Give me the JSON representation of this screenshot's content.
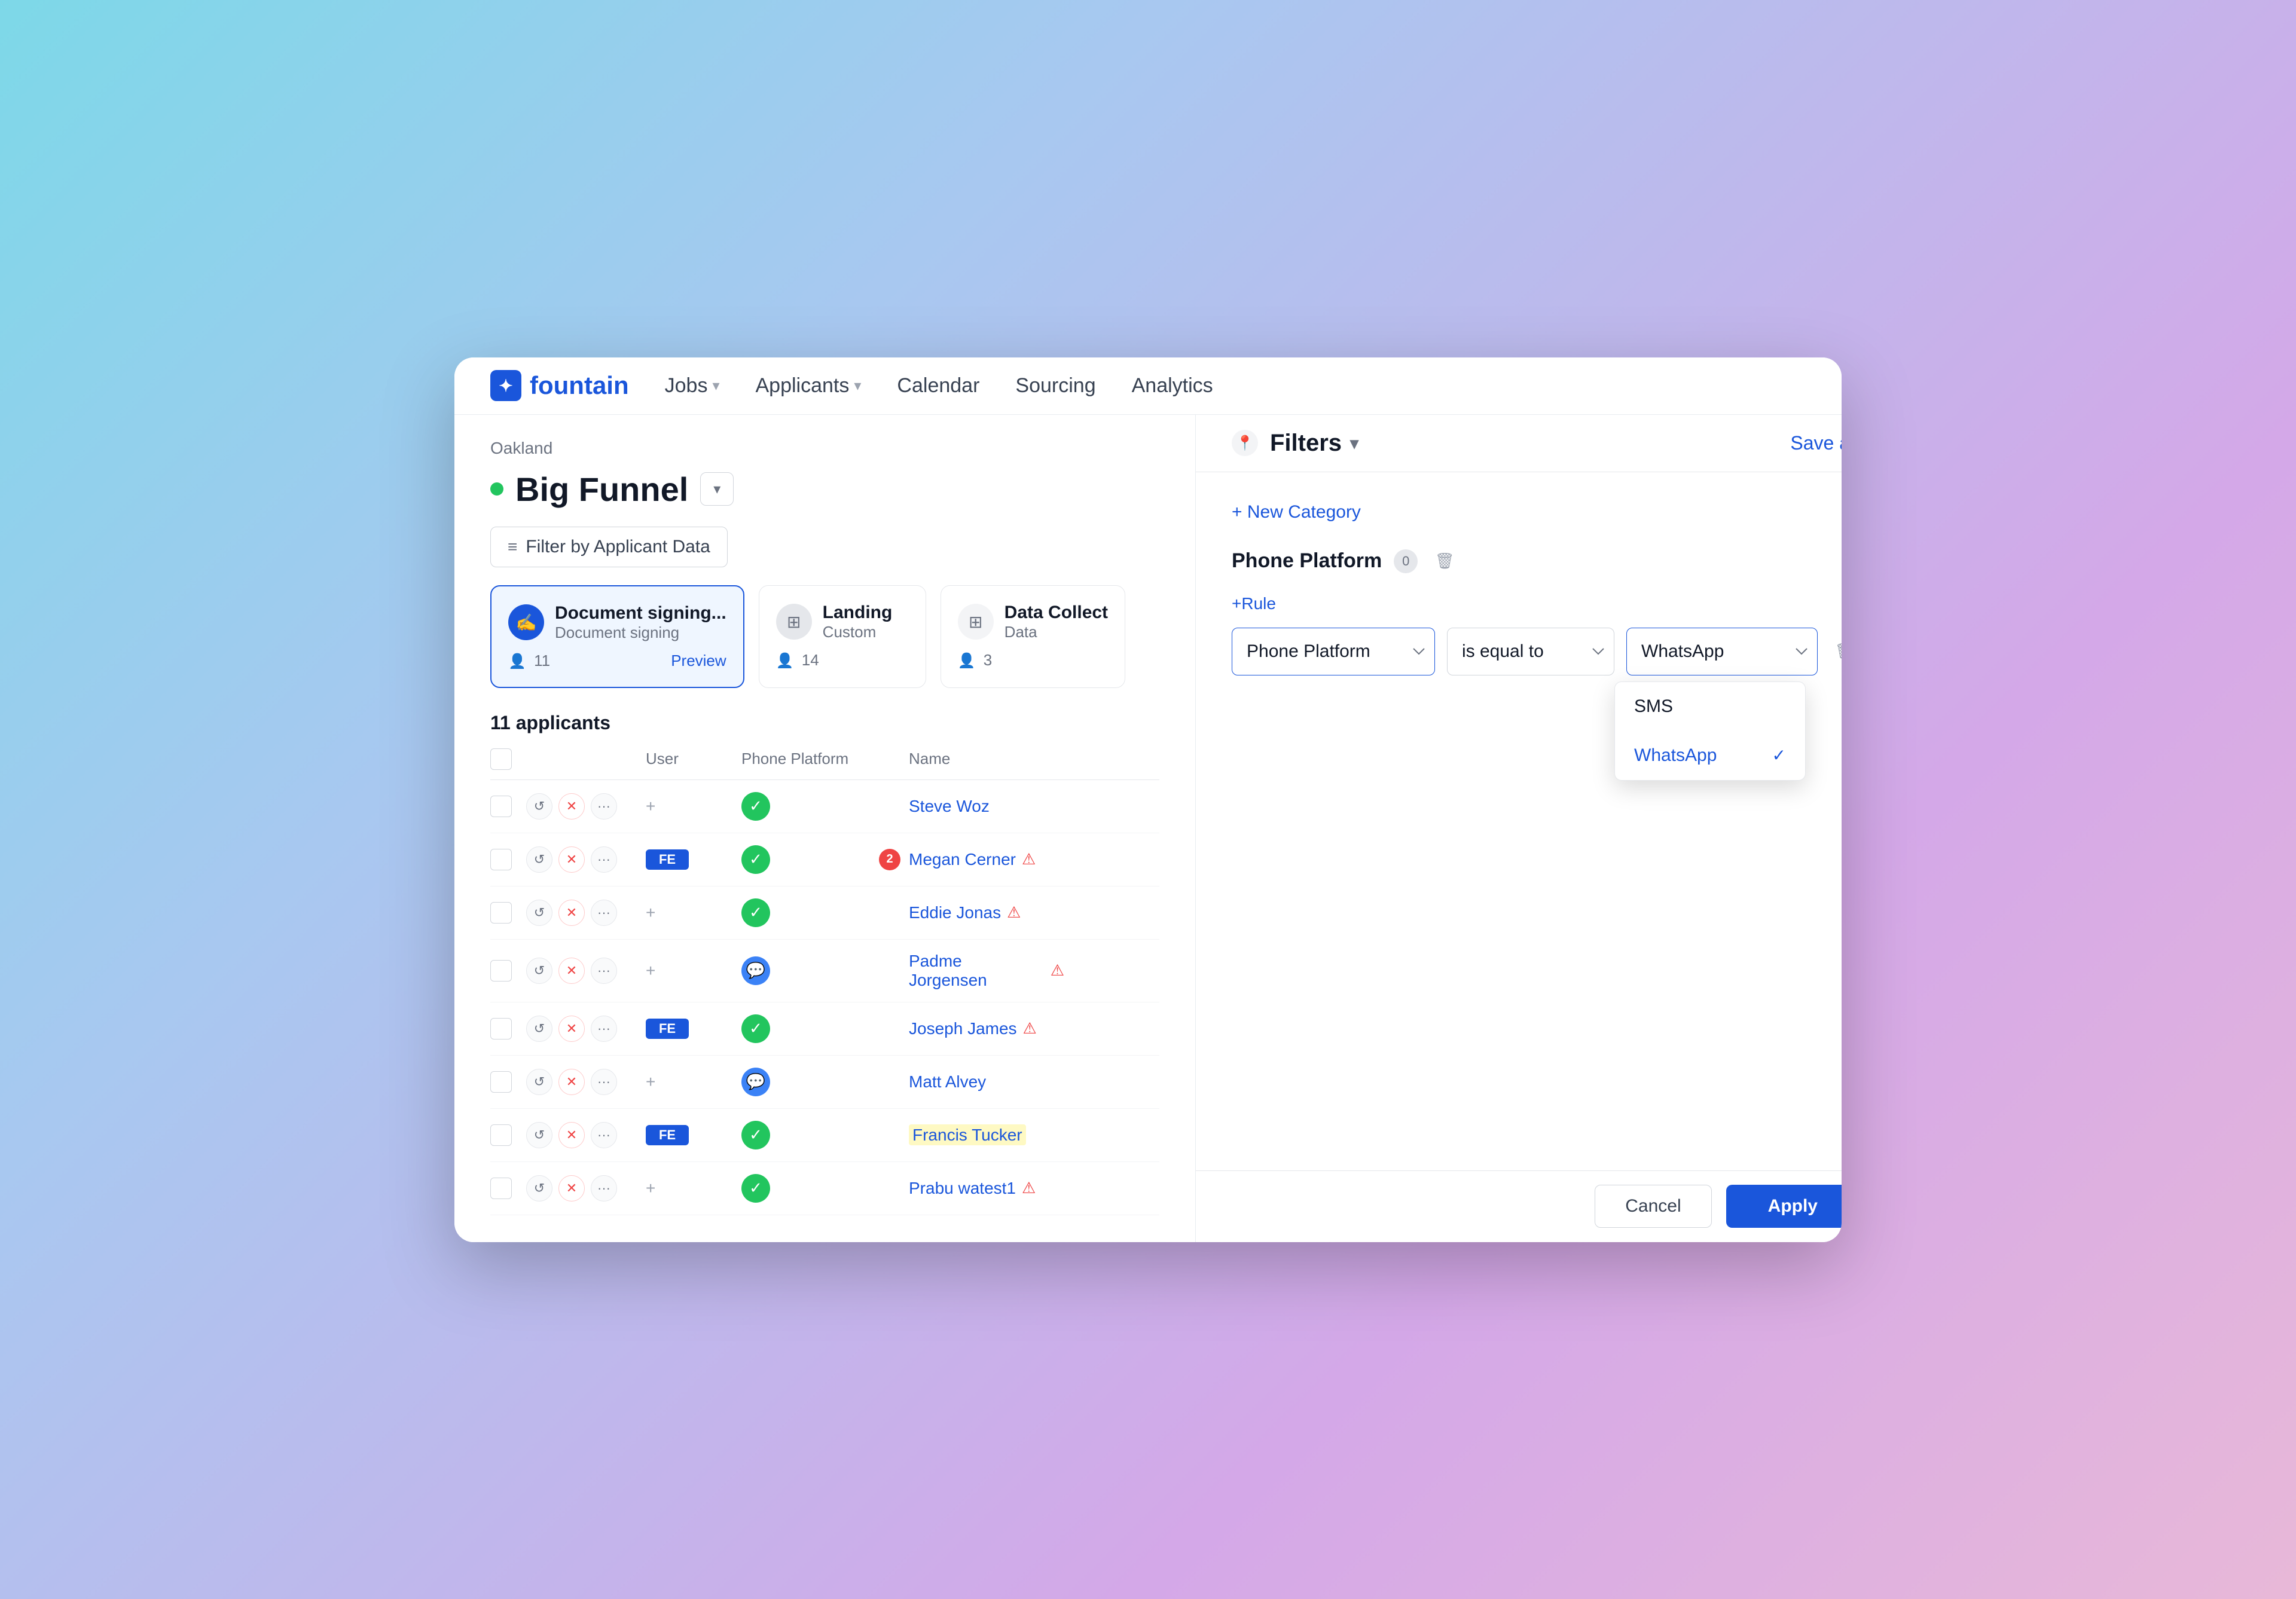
{
  "app": {
    "logo_text": "fountain",
    "nav": {
      "jobs": "Jobs",
      "applicants": "Applicants",
      "calendar": "Calendar",
      "sourcing": "Sourcing",
      "analytics": "Analytics"
    }
  },
  "left_panel": {
    "breadcrumb": "Oakland",
    "funnel_title": "Big Funnel",
    "filter_button": "Filter by Applicant Data",
    "stages": [
      {
        "title": "Document signing...",
        "subtitle": "Document signing",
        "count": "11",
        "show_preview": true,
        "active": true,
        "icon_type": "blue"
      },
      {
        "title": "Landing",
        "subtitle": "Custom",
        "count": "14",
        "show_preview": false,
        "active": false,
        "icon_type": "gray"
      },
      {
        "title": "Data Collect",
        "subtitle": "Data",
        "count": "3",
        "show_preview": false,
        "active": false,
        "icon_type": "light"
      }
    ],
    "applicants_count": "11 applicants",
    "table_headers": {
      "user": "User",
      "phone": "Phone Platform",
      "dot": "●",
      "name": "Name"
    },
    "rows": [
      {
        "user": "+",
        "phone": "whatsapp",
        "name": "Steve Woz",
        "badge": null,
        "status": null
      },
      {
        "user": "FE",
        "phone": "whatsapp",
        "name": "Megan Cerner",
        "badge": "2",
        "status": "alert"
      },
      {
        "user": "+",
        "phone": "whatsapp",
        "name": "Eddie Jonas",
        "badge": null,
        "status": "alert"
      },
      {
        "user": "+",
        "phone": "sms",
        "name": "Padme Jorgensen",
        "badge": null,
        "status": "alert"
      },
      {
        "user": "FE",
        "phone": "whatsapp",
        "name": "Joseph James",
        "badge": null,
        "status": "alert"
      },
      {
        "user": "+",
        "phone": "sms",
        "name": "Matt Alvey",
        "badge": null,
        "status": null
      },
      {
        "user": "FE",
        "phone": "whatsapp",
        "name": "Francis Tucker",
        "badge": null,
        "status": null,
        "highlighted": true
      },
      {
        "user": "+",
        "phone": "whatsapp",
        "name": "Prabu watest1",
        "badge": null,
        "status": "alert"
      }
    ]
  },
  "right_panel": {
    "title": "Filters",
    "save_as": "Save as",
    "new_category": "+ New Category",
    "category": {
      "title": "Phone Platform",
      "badge": "0",
      "add_rule": "+Rule"
    },
    "rule": {
      "field": "Phone Platform",
      "operator": "is equal to",
      "value": "WhatsApp"
    },
    "dropdown_options": [
      {
        "label": "SMS",
        "selected": false
      },
      {
        "label": "WhatsApp",
        "selected": true
      }
    ],
    "footer": {
      "cancel": "Cancel",
      "apply": "Apply"
    }
  }
}
